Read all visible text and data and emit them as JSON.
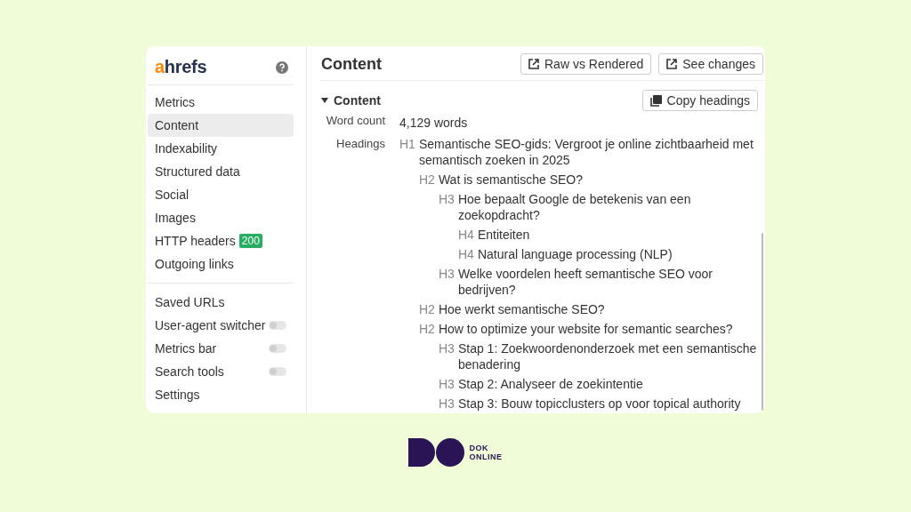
{
  "sidebar": {
    "brand": {
      "accent": "a",
      "rest": "hrefs"
    },
    "sections": [
      {
        "items": [
          {
            "label": "Metrics",
            "selected": false,
            "kind": "link"
          },
          {
            "label": "Content",
            "selected": true,
            "kind": "link"
          },
          {
            "label": "Indexability",
            "selected": false,
            "kind": "link"
          },
          {
            "label": "Structured data",
            "selected": false,
            "kind": "link"
          },
          {
            "label": "Social",
            "selected": false,
            "kind": "link"
          },
          {
            "label": "Images",
            "selected": false,
            "kind": "link"
          },
          {
            "label": "HTTP headers",
            "selected": false,
            "kind": "link",
            "badge": "200"
          },
          {
            "label": "Outgoing links",
            "selected": false,
            "kind": "link"
          }
        ]
      },
      {
        "items": [
          {
            "label": "Saved URLs",
            "selected": false,
            "kind": "link"
          },
          {
            "label": "User-agent switcher",
            "selected": false,
            "kind": "toggle",
            "on": false
          },
          {
            "label": "Metrics bar",
            "selected": false,
            "kind": "toggle",
            "on": false
          },
          {
            "label": "Search tools",
            "selected": false,
            "kind": "toggle",
            "on": false
          },
          {
            "label": "Settings",
            "selected": false,
            "kind": "link"
          }
        ]
      }
    ]
  },
  "main": {
    "title": "Content",
    "buttons": [
      "Raw vs Rendered",
      "See changes"
    ],
    "section": {
      "title": "Content",
      "expanded": true,
      "copy_button": "Copy headings",
      "word_count": {
        "label": "Word count",
        "value": "4,129 words"
      },
      "headings_label": "Headings",
      "headings": [
        {
          "level": "H1",
          "text": "Semantische SEO-gids: Vergroot je online zichtbaarheid met semantisch zoeken in 2025",
          "children": [
            {
              "level": "H2",
              "text": "Wat is semantische SEO?",
              "children": [
                {
                  "level": "H3",
                  "text": "Hoe bepaalt Google de betekenis van een zoekopdracht?",
                  "children": [
                    {
                      "level": "H4",
                      "text": "Entiteiten"
                    },
                    {
                      "level": "H4",
                      "text": "Natural language processing (NLP)"
                    }
                  ]
                },
                {
                  "level": "H3",
                  "text": "Welke voordelen heeft semantische SEO voor bedrijven?"
                }
              ]
            },
            {
              "level": "H2",
              "text": "Hoe werkt semantische SEO?"
            },
            {
              "level": "H2",
              "text": "How to optimize your website for semantic searches?",
              "children": [
                {
                  "level": "H3",
                  "text": "Stap 1: Zoekwoordenonderzoek met een semantische benadering"
                },
                {
                  "level": "H3",
                  "text": "Stap 2: Analyseer de zoekintentie"
                },
                {
                  "level": "H3",
                  "text": "Stap 3: Bouw topicclusters op voor topical authority"
                }
              ]
            }
          ]
        }
      ]
    }
  },
  "footer_logo": {
    "lines": [
      "DOK",
      "ONLINE"
    ]
  }
}
